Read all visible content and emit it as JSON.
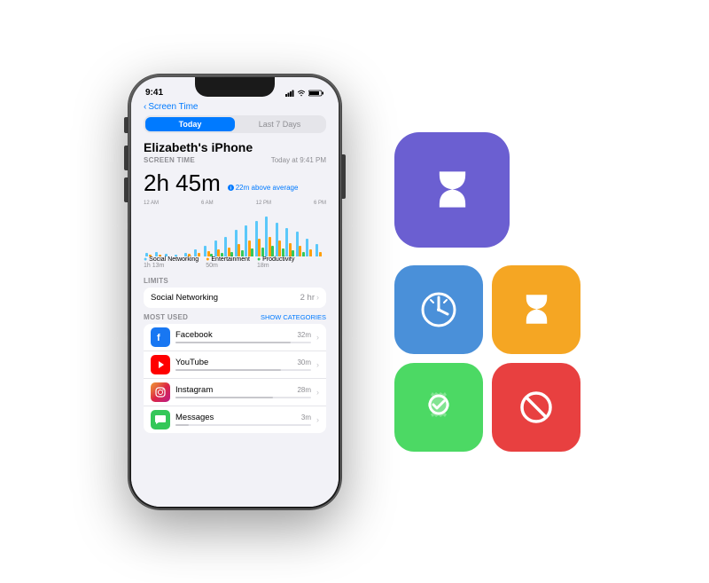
{
  "phone": {
    "status_time": "9:41",
    "back_label": "Screen Time",
    "segment": {
      "today": "Today",
      "last7": "Last 7 Days"
    },
    "device_name": "Elizabeth's iPhone",
    "section_screen_time": "SCREEN TIME",
    "date_label": "Today at 9:41 PM",
    "total_time": "2h 45m",
    "avg_label": "22m above average",
    "chart_labels": [
      "12 AM",
      "6 AM",
      "12 PM",
      "6 PM"
    ],
    "categories": [
      {
        "name": "Social Networking",
        "time": "1h 13m"
      },
      {
        "name": "Entertainment",
        "time": "50m"
      },
      {
        "name": "Productivity",
        "time": "18m"
      }
    ],
    "limits_label": "LIMITS",
    "limits": [
      {
        "name": "Social Networking",
        "value": "2 hr"
      }
    ],
    "most_used_label": "MOST USED",
    "show_categories": "SHOW CATEGORIES",
    "apps": [
      {
        "name": "Facebook",
        "time": "32m",
        "bar_pct": 85,
        "icon": "facebook"
      },
      {
        "name": "YouTube",
        "time": "30m",
        "bar_pct": 78,
        "icon": "youtube"
      },
      {
        "name": "Instagram",
        "time": "28m",
        "bar_pct": 72,
        "icon": "instagram"
      },
      {
        "name": "Messages",
        "time": "3m",
        "bar_pct": 10,
        "icon": "messages"
      }
    ]
  },
  "icons": {
    "large": {
      "label": "Screen Time",
      "color": "purple"
    },
    "grid": [
      {
        "label": "Usage",
        "color": "blue"
      },
      {
        "label": "Screen Time",
        "color": "orange"
      },
      {
        "label": "Settings",
        "color": "green"
      },
      {
        "label": "Restrictions",
        "color": "red"
      }
    ]
  }
}
